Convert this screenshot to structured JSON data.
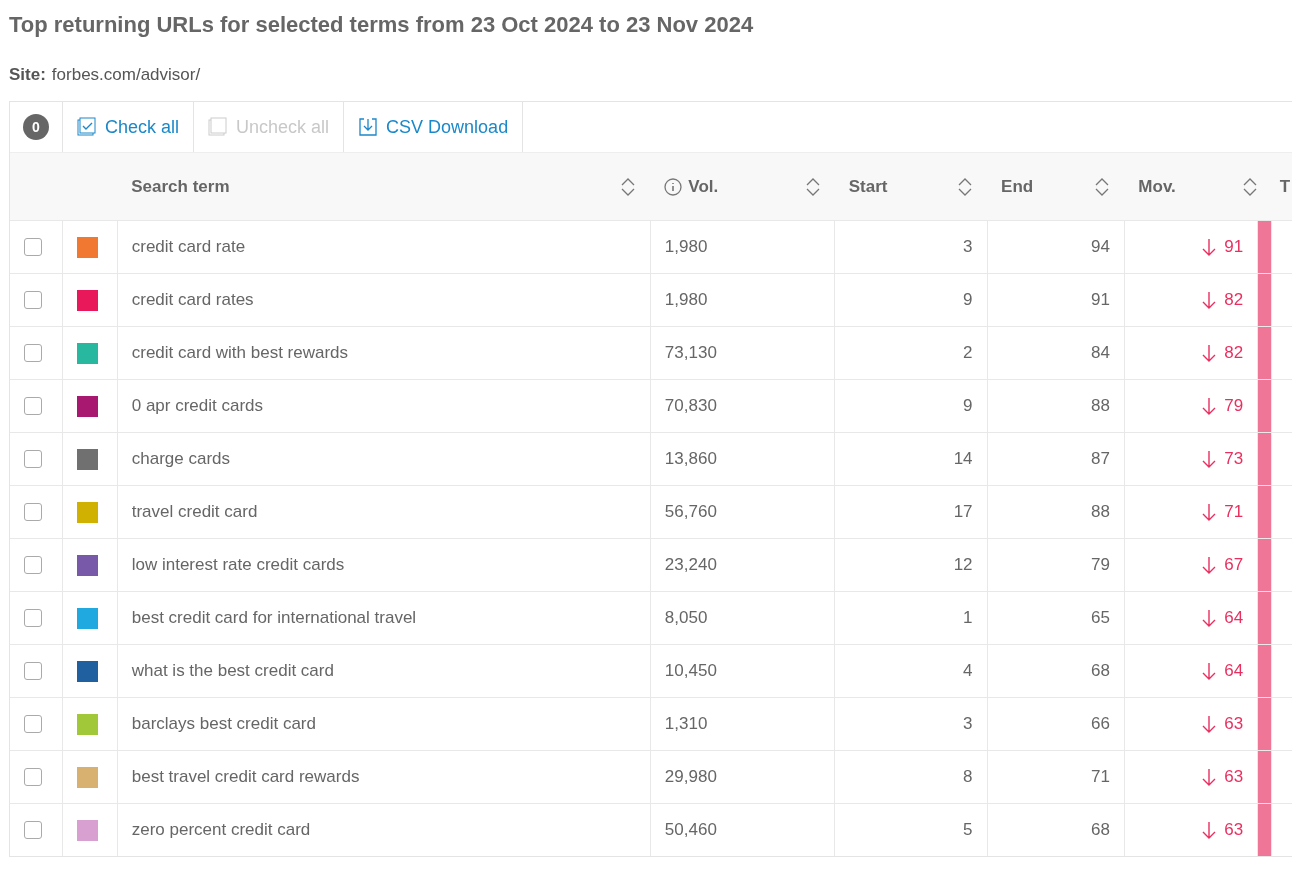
{
  "title": "Top returning URLs for selected terms from 23 Oct 2024 to 23 Nov 2024",
  "site": {
    "label": "Site:",
    "value": "forbes.com/advisor/"
  },
  "toolbar": {
    "count": "0",
    "buttons": [
      {
        "kind": "check",
        "label": "Check all",
        "disabled": false
      },
      {
        "kind": "uncheck",
        "label": "Uncheck all",
        "disabled": true
      },
      {
        "kind": "download",
        "label": "CSV Download",
        "disabled": false
      }
    ]
  },
  "columns": [
    {
      "label": "Search term",
      "info": false
    },
    {
      "label": "Vol.",
      "info": true
    },
    {
      "label": "Start",
      "info": false
    },
    {
      "label": "End",
      "info": false
    },
    {
      "label": "Mov.",
      "info": false
    },
    {
      "label": "T",
      "info": false
    }
  ],
  "rows": [
    {
      "checked": false,
      "color": "#f07830",
      "term": "credit card rate",
      "vol": "1,980",
      "start": "3",
      "end": "94",
      "kind": "down",
      "mov": "91"
    },
    {
      "checked": false,
      "color": "#e8185a",
      "term": "credit card rates",
      "vol": "1,980",
      "start": "9",
      "end": "91",
      "kind": "down",
      "mov": "82"
    },
    {
      "checked": false,
      "color": "#28b8a0",
      "term": "credit card with best rewards",
      "vol": "73,130",
      "start": "2",
      "end": "84",
      "kind": "down",
      "mov": "82"
    },
    {
      "checked": false,
      "color": "#a81870",
      "term": "0 apr credit cards",
      "vol": "70,830",
      "start": "9",
      "end": "88",
      "kind": "down",
      "mov": "79"
    },
    {
      "checked": false,
      "color": "#707070",
      "term": "charge cards",
      "vol": "13,860",
      "start": "14",
      "end": "87",
      "kind": "down",
      "mov": "73"
    },
    {
      "checked": false,
      "color": "#d0b000",
      "term": "travel credit card",
      "vol": "56,760",
      "start": "17",
      "end": "88",
      "kind": "down",
      "mov": "71"
    },
    {
      "checked": false,
      "color": "#7858a8",
      "term": "low interest rate credit cards",
      "vol": "23,240",
      "start": "12",
      "end": "79",
      "kind": "down",
      "mov": "67"
    },
    {
      "checked": false,
      "color": "#20a8e0",
      "term": "best credit card for international travel",
      "vol": "8,050",
      "start": "1",
      "end": "65",
      "kind": "down",
      "mov": "64"
    },
    {
      "checked": false,
      "color": "#2060a0",
      "term": "what is the best credit card",
      "vol": "10,450",
      "start": "4",
      "end": "68",
      "kind": "down",
      "mov": "64"
    },
    {
      "checked": false,
      "color": "#a0c838",
      "term": "barclays best credit card",
      "vol": "1,310",
      "start": "3",
      "end": "66",
      "kind": "down",
      "mov": "63"
    },
    {
      "checked": false,
      "color": "#d8b070",
      "term": "best travel credit card rewards",
      "vol": "29,980",
      "start": "8",
      "end": "71",
      "kind": "down",
      "mov": "63"
    },
    {
      "checked": false,
      "color": "#d8a0d0",
      "term": "zero percent credit card",
      "vol": "50,460",
      "start": "5",
      "end": "68",
      "kind": "down",
      "mov": "63"
    }
  ]
}
